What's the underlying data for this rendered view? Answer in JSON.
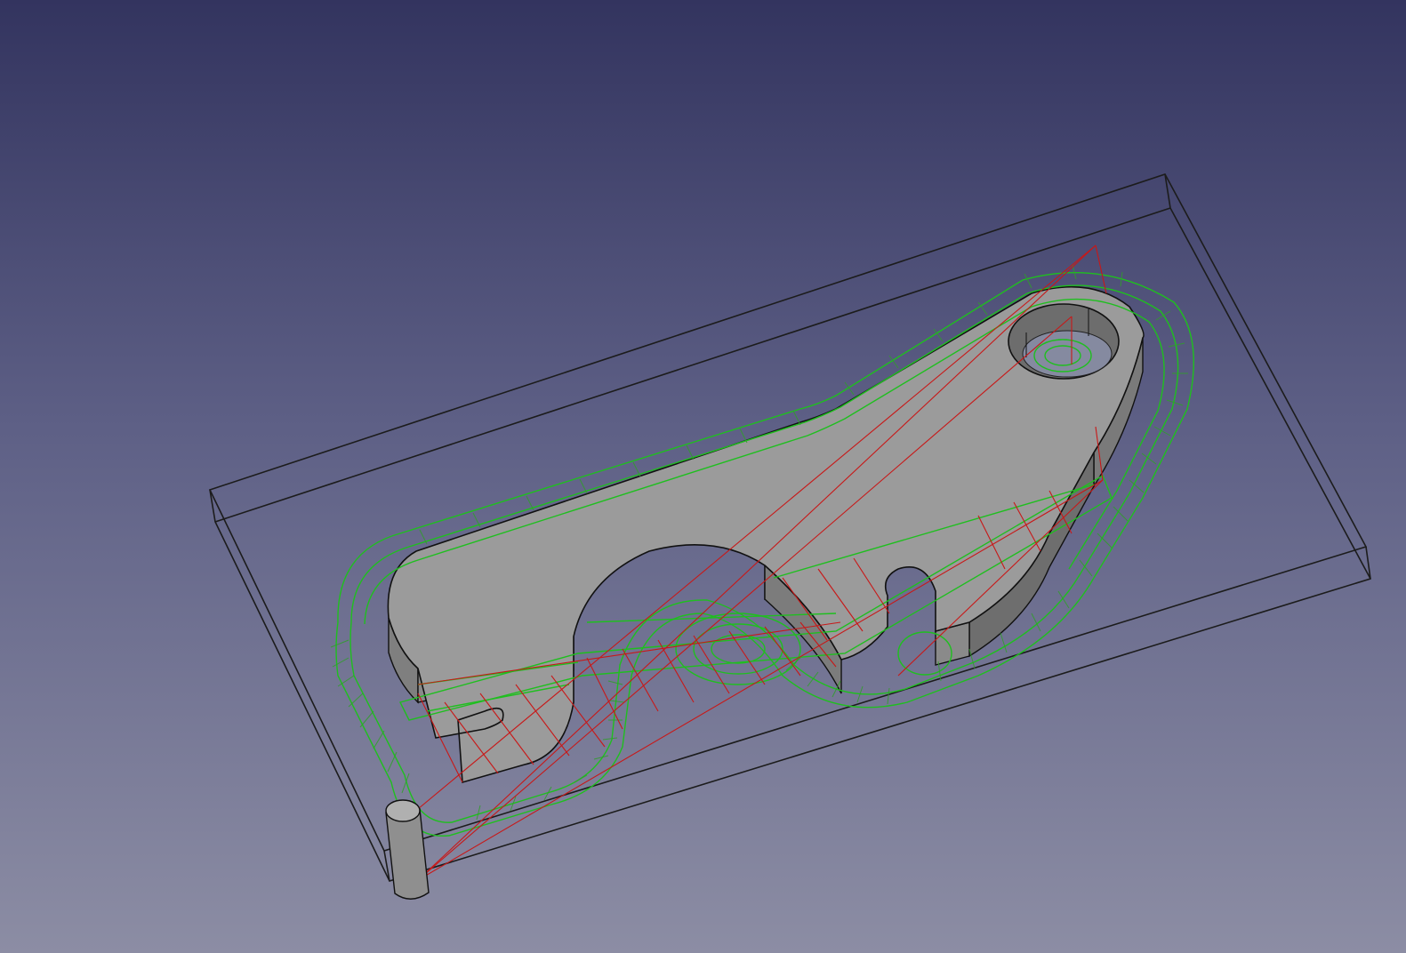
{
  "viewport": {
    "background_top": "#33345f",
    "background_bottom": "#8c8da4"
  },
  "scene": {
    "stock_edge_color": "#1c1c1c",
    "part_face_color": "#9b9b9b",
    "part_wall_color": "#8a8a8a",
    "part_edge_color": "#111111",
    "feed_path_color": "#1fbf1f",
    "rapid_path_color": "#c81818",
    "tool_color": "#9a9a9a"
  }
}
